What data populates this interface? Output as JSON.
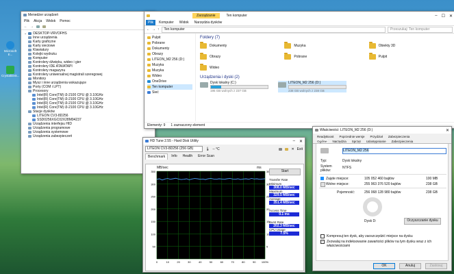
{
  "desktop": {
    "icons": [
      {
        "label": "Microsoft E..."
      },
      {
        "label": "CrystalDisk..."
      }
    ]
  },
  "devmgr": {
    "title": "Menedżer urządzeń",
    "menu": [
      "Plik",
      "Akcja",
      "Widok",
      "Pomoc"
    ],
    "root": "DESKTOP-VRVOFHS",
    "tree": [
      {
        "label": "Inne urządzenia",
        "indent": 1
      },
      {
        "label": "Karty graficzne",
        "indent": 1
      },
      {
        "label": "Karty sieciowe",
        "indent": 1
      },
      {
        "label": "Klawiatury",
        "indent": 1
      },
      {
        "label": "Kolejki wydruku",
        "indent": 1
      },
      {
        "label": "Komputer",
        "indent": 1
      },
      {
        "label": "Kontrolery dźwięku, wideo i gier",
        "indent": 1
      },
      {
        "label": "Kontrolery IDE ATA/ATAPI",
        "indent": 1
      },
      {
        "label": "Kontrolery magazynu",
        "indent": 1
      },
      {
        "label": "Kontrolery uniwersalnej magistrali szeregowej",
        "indent": 1
      },
      {
        "label": "Monitory",
        "indent": 1
      },
      {
        "label": "Mysz i inne urządzenia wskazujące",
        "indent": 1
      },
      {
        "label": "Porty (COM i LPT)",
        "indent": 1
      },
      {
        "label": "Procesory",
        "indent": 1
      },
      {
        "label": "Intel(R) Core(TM) i3-2100 CPU @ 3.10GHz",
        "indent": 2
      },
      {
        "label": "Intel(R) Core(TM) i3-2100 CPU @ 3.10GHz",
        "indent": 2
      },
      {
        "label": "Intel(R) Core(TM) i3-2100 CPU @ 3.10GHz",
        "indent": 2
      },
      {
        "label": "Intel(R) Core(TM) i3-2100 CPU @ 3.10GHz",
        "indent": 2
      },
      {
        "label": "Stacje dysków",
        "indent": 1
      },
      {
        "label": "LITEON CV3-8D256",
        "indent": 2
      },
      {
        "label": "SSD0256XGC02X28M94237",
        "indent": 2
      },
      {
        "label": "Urządzenia interfejsu HID",
        "indent": 1
      },
      {
        "label": "Urządzenia programowe",
        "indent": 1
      },
      {
        "label": "Urządzenia systemowe",
        "indent": 1
      },
      {
        "label": "Urządzenia zabezpieczeń",
        "indent": 1
      }
    ]
  },
  "explorer": {
    "ribbon_context": "Zarządzanie",
    "title": "Ten komputer",
    "tabs": [
      "Plik",
      "Komputer",
      "Widok",
      "Narzędzia dysków"
    ],
    "address": "Ten komputer",
    "search_placeholder": "Przeszukaj: Ten komputer",
    "nav": [
      "Pulpit",
      "Pobrane",
      "Dokumenty",
      "Obrazy",
      "LITEON_M2 256 (D:)",
      "Muzyka",
      "Muzyka",
      "Wideo",
      "OneDrive",
      "Ten komputer",
      "Sieć"
    ],
    "folders_header": "Foldery (7)",
    "folders": [
      "Dokumenty",
      "Muzyka",
      "Obiekty 3D",
      "Obrazy",
      "Pobrane",
      "Pulpit",
      "Wideo"
    ],
    "drives_header": "Urządzenia i dyski (2)",
    "drives": [
      {
        "name": "Dysk lokalny (C:)",
        "free": "195 GB wolnych z 237 GB",
        "used_fraction": 0.18
      },
      {
        "name": "LITEON_M2 256 (D:)",
        "free": "238 GB wolnych z 238 GB",
        "used_fraction": 0.0
      }
    ],
    "status_items": "Elementy: 9",
    "status_selected": "1 zaznaczony element"
  },
  "hdtune": {
    "title": "HD Tune 2.55 - Hard Disk Utility",
    "drive": "LITEON  CV3-8D256 (256 GB)",
    "temp": "-- °C",
    "exit": "Exit",
    "tabs": [
      "Benchmark",
      "Info",
      "Health",
      "Error Scan"
    ],
    "y_unit": "MB/sec",
    "y_unit_right": "ms",
    "start": "Start",
    "transfer_rate": "Transfer Rate",
    "minimum_label": "Minimum",
    "minimum": "308.0 MB/sec",
    "maximum_label": "Maximum",
    "maximum": "329.5 MB/sec",
    "average_label": "Average",
    "average": "351.4 MB/sec",
    "access_label": "Access Time",
    "access": "0.1 ms",
    "burst_label": "Burst Rate",
    "burst": "202.3 MB/sec",
    "cpu_label": "CPU Usage",
    "cpu": "7.5%",
    "chart_data": {
      "type": "line",
      "y_ticks_left": [
        "350",
        "300",
        "250",
        "200",
        "150",
        "100",
        "50"
      ],
      "y_ticks_right": [
        "35",
        "30",
        "25",
        "20",
        "15",
        "10",
        "5"
      ],
      "x_ticks": [
        "0",
        "10",
        "20",
        "30",
        "40",
        "50",
        "60",
        "70",
        "80",
        "90",
        "100%"
      ],
      "ylim": [
        0,
        350
      ],
      "series": [
        {
          "values": [
            318,
            320,
            315,
            319,
            321,
            318,
            320,
            322,
            319,
            317,
            318,
            320,
            316,
            319,
            321,
            320,
            318,
            319,
            317,
            320,
            321,
            319,
            318,
            320,
            319,
            318,
            320,
            321,
            319,
            318,
            320,
            317,
            319,
            320,
            318,
            321,
            319,
            320,
            318,
            319,
            320
          ]
        }
      ]
    }
  },
  "props": {
    "title": "Właściwości: LITEON_M2 256 (D:)",
    "tabs_row1": [
      "Zabezpieczenia",
      "Poprzednie wersje",
      "Przydział",
      "Sprzęt",
      "Udostępnianie"
    ],
    "tabs_row2": [
      "Ogólne",
      "Narzędzia",
      "Sprzęt",
      "Udostępnianie",
      "Zabezpieczenia"
    ],
    "tab_selected": "Ogólne",
    "tab_top": "Poprzednie wersje",
    "tab_top2": "Przydział",
    "tab_readyboost": "ReadyBoost",
    "label_value": "LITEON_M2 256",
    "type_label": "Typ:",
    "type_value": "Dysk lokalny",
    "fs_label": "System plików:",
    "fs_value": "NTFS",
    "used_label": "Zajęte miejsce:",
    "used_bytes": "105 052 460 bajtów",
    "used_short": "100 MB",
    "free_label": "Wolne miejsce:",
    "free_bytes": "255 963 376 520 bajtów",
    "free_short": "238 GB",
    "cap_label": "Pojemność:",
    "cap_bytes": "256 068 128 980 bajtów",
    "cap_short": "238 GB",
    "disk_label": "Dysk D:",
    "cleanup": "Oczyszczanie dysku",
    "compress": "Kompresuj ten dysk, aby zaoszczędzić miejsce na dysku",
    "index": "Zezwalaj na indeksowanie zawartości plików na tym dysku wraz z ich właściwościami",
    "ok": "OK",
    "cancel": "Anuluj",
    "apply": "Zastosuj",
    "used_fraction": 0.0004
  }
}
